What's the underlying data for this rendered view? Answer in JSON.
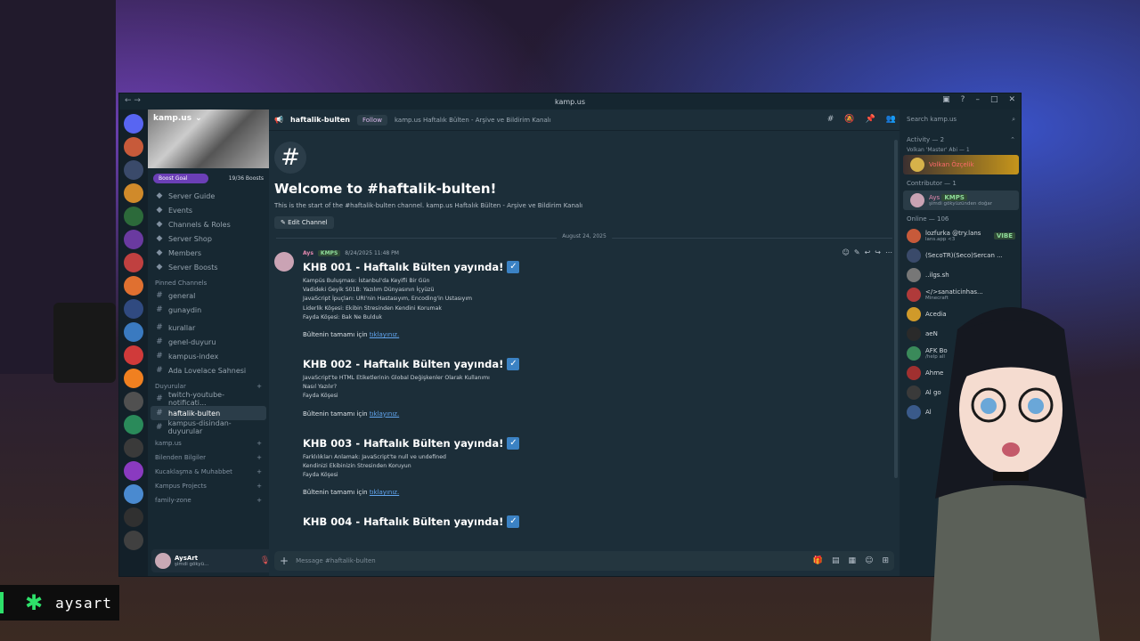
{
  "window": {
    "title": "kamp.us"
  },
  "servers": {
    "colors": [
      "#c75a3a",
      "#3a4a6a",
      "#d08a2a",
      "#2c6a3a",
      "#6a3aa0",
      "#c04040",
      "#e07030",
      "#304a80",
      "#3a7ac0",
      "#d03a3a",
      "#f08020",
      "#505050",
      "#2a8a5a",
      "#3a3a3a",
      "#8a3ac0",
      "#4a8ad0",
      "#303030",
      "#404040"
    ]
  },
  "sidebar": {
    "server_name": "kamp.us",
    "boost_goal": "Boost Goal",
    "boost_count": "19/36 Boosts",
    "top_items": [
      {
        "label": "Server Guide",
        "icon": "guide-icon"
      },
      {
        "label": "Events",
        "icon": "calendar-icon"
      },
      {
        "label": "Channels & Roles",
        "icon": "channels-icon"
      },
      {
        "label": "Server Shop",
        "icon": "shop-icon"
      },
      {
        "label": "Members",
        "icon": "members-icon"
      },
      {
        "label": "Server Boosts",
        "icon": "boost-icon"
      }
    ],
    "pinned_header": "Pinned Channels",
    "pinned": [
      "general",
      "gunaydin"
    ],
    "channels": [
      "kurallar",
      "genel-duyuru",
      "kampus-index",
      "Ada Lovelace Sahnesi"
    ],
    "duyurular_header": "Duyurular",
    "duyurular": [
      "twitch-youtube-notificati...",
      "haftalik-bulten",
      "kampus-disindan-duyurular"
    ],
    "categories": [
      "kamp.us",
      "Bilenden Bilgiler",
      "Kucaklaşma & Muhabbet"
    ],
    "projects": "Kampus Projects",
    "family": "family-zone",
    "user": {
      "name": "AysArt",
      "status": "şimdi gökyü..."
    }
  },
  "topbar": {
    "channel": "haftalik-bulten",
    "follow": "Follow",
    "topic": "kamp.us Haftalık Bülten - Arşive ve Bildirim Kanalı"
  },
  "welcome": {
    "title": "Welcome to #haftalik-bulten!",
    "subtitle": "This is the start of the #haftalik-bulten channel. kamp.us Haftalık Bülten - Arşive ve Bildirim Kanalı",
    "edit": "Edit Channel"
  },
  "date_divider": "August 24, 2025",
  "message": {
    "author": "Ays",
    "tag": "KMPS",
    "timestamp": "8/24/2025 11:48 PM",
    "read_more_prefix": "Bültenin tamamı için",
    "read_more_link": "tıklayınız.",
    "bulletins": [
      {
        "title": "KHB 001 - Haftalık Bülten yayında!",
        "lines": [
          "Kampüs Buluşması: İstanbul'da Keyifli Bir Gün",
          "Vadideki Geyik S01B: Yazılım Dünyasının İçyüzü",
          "JavaScript İpuçları: URI'nin Hastasıyım, Encoding'in Ustasıyım",
          "Liderlik Köşesi: Ekibin Stresinden Kendini Korumak",
          "Fayda Köşesi: Bak Ne Bulduk"
        ]
      },
      {
        "title": "KHB 002 - Haftalık Bülten yayında!",
        "lines": [
          "JavaScript'te HTML Etiketlerinin Global Değişkenler Olarak Kullanımı",
          "Nasıl Yazılır?",
          "Fayda Köşesi"
        ]
      },
      {
        "title": "KHB 003 - Haftalık Bülten yayında!",
        "lines": [
          "Farklılıkları Anlamak: JavaScript'te null ve undefined",
          "Kendinizi Ekibinizin Stresinden Koruyun",
          "Fayda Köşesi"
        ]
      },
      {
        "title": "KHB 004 - Haftalık Bülten yayında!",
        "lines": []
      }
    ]
  },
  "composer": {
    "placeholder": "Message #haftalik-bulten"
  },
  "members": {
    "search_placeholder": "Search kamp.us",
    "activity_header": "Activity — 2",
    "role_volkan": "Volkan 'Master' Abi — 1",
    "volkan_name": "Volkan Özçelik",
    "contributor_header": "Contributor — 1",
    "contributor_name": "Ays",
    "contributor_tag": "KMPS",
    "contributor_status": "şimdi gökyüzünden doğar",
    "online_header": "Online — 106",
    "online": [
      {
        "name": "lozfurka @try.lans",
        "status": "lans.app <3",
        "badge": "VIBE"
      },
      {
        "name": "(SecoTR)(Seco)Sercan ...",
        "status": ""
      },
      {
        "name": "..ilgs.sh",
        "status": ""
      },
      {
        "name": "</>sanaticinhas...",
        "status": "Minecraft"
      },
      {
        "name": "Acedia",
        "status": ""
      },
      {
        "name": "aeN",
        "status": ""
      },
      {
        "name": "AFK Bo",
        "status": "/help all"
      },
      {
        "name": "Ahme",
        "status": ""
      },
      {
        "name": "Al go",
        "status": ""
      },
      {
        "name": "Al",
        "status": ""
      }
    ]
  },
  "brand": {
    "name": "aysart"
  }
}
